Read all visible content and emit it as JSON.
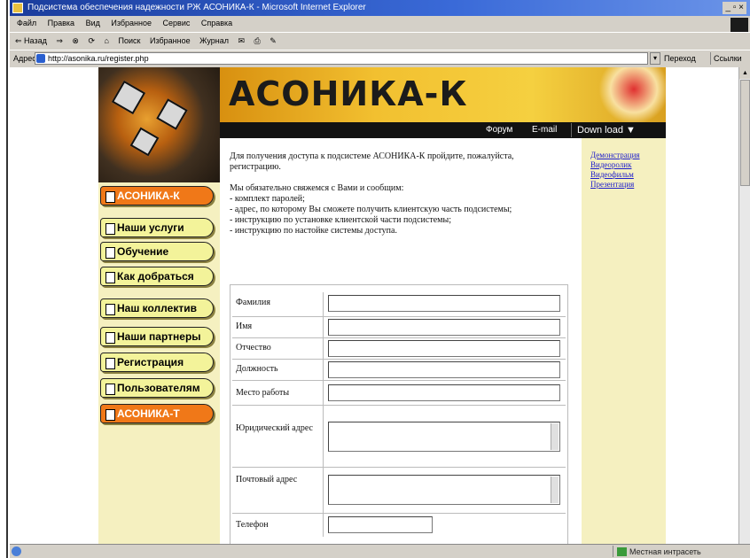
{
  "window": {
    "title": "Подсистема обеспечения надежности РЖ АСОНИКА-К - Microsoft Internet Explorer",
    "controls": "_ ▫ ×"
  },
  "menu": [
    "Файл",
    "Правка",
    "Вид",
    "Избранное",
    "Сервис",
    "Справка"
  ],
  "toolbar": [
    "⇐ Назад",
    "⇒",
    "⊗",
    "⟳",
    "⌂",
    "Поиск",
    "Избранное",
    "Журнал",
    "✉",
    "⎙",
    "✎"
  ],
  "address": {
    "label": "Адрес",
    "url": "http://asonika.ru/register.php",
    "go": "Переход",
    "links": "Ссылки"
  },
  "status": {
    "zone": "Местная интрасеть"
  },
  "site": {
    "header_title": "АСОНИКА-К",
    "forum": "Форум",
    "email": "E-mail",
    "download": "Down load ▼",
    "nav": [
      {
        "label": "АСОНИКА-К",
        "active": true
      },
      {
        "label": "Наши услуги",
        "active": false
      },
      {
        "label": "Обучение",
        "active": false
      },
      {
        "label": "Как добраться",
        "active": false
      },
      {
        "label": "Наш коллектив",
        "active": false
      },
      {
        "label": "Наши партнеры",
        "active": false
      },
      {
        "label": "Регистрация",
        "active": false
      },
      {
        "label": "Пользователям",
        "active": false
      },
      {
        "label": "АСОНИКА-Т",
        "active": true
      }
    ],
    "intro_p1": "Для получения доступа к подсистеме АСОНИКА-К пройдите, пожалуйста, регистрацию.",
    "intro_p2_lines": [
      "Мы обязательно свяжемся с Вами и сообщим:",
      "- комплект паролей;",
      "- адрес, по которому Вы сможете получить клиентскую часть подсистемы;",
      "- инструкцию по установке клиентской части подсистемы;",
      "- инструкцию по настойке системы доступа."
    ],
    "side_links": [
      "Демонстрация",
      "Видеоролик",
      "Видеофильм",
      "Презентация"
    ],
    "form": {
      "fields": [
        "Фамилия",
        "Имя",
        "Отчество",
        "Должность",
        "Место работы",
        "Юридический адрес",
        "Почтовый адрес",
        "Телефон"
      ]
    }
  }
}
